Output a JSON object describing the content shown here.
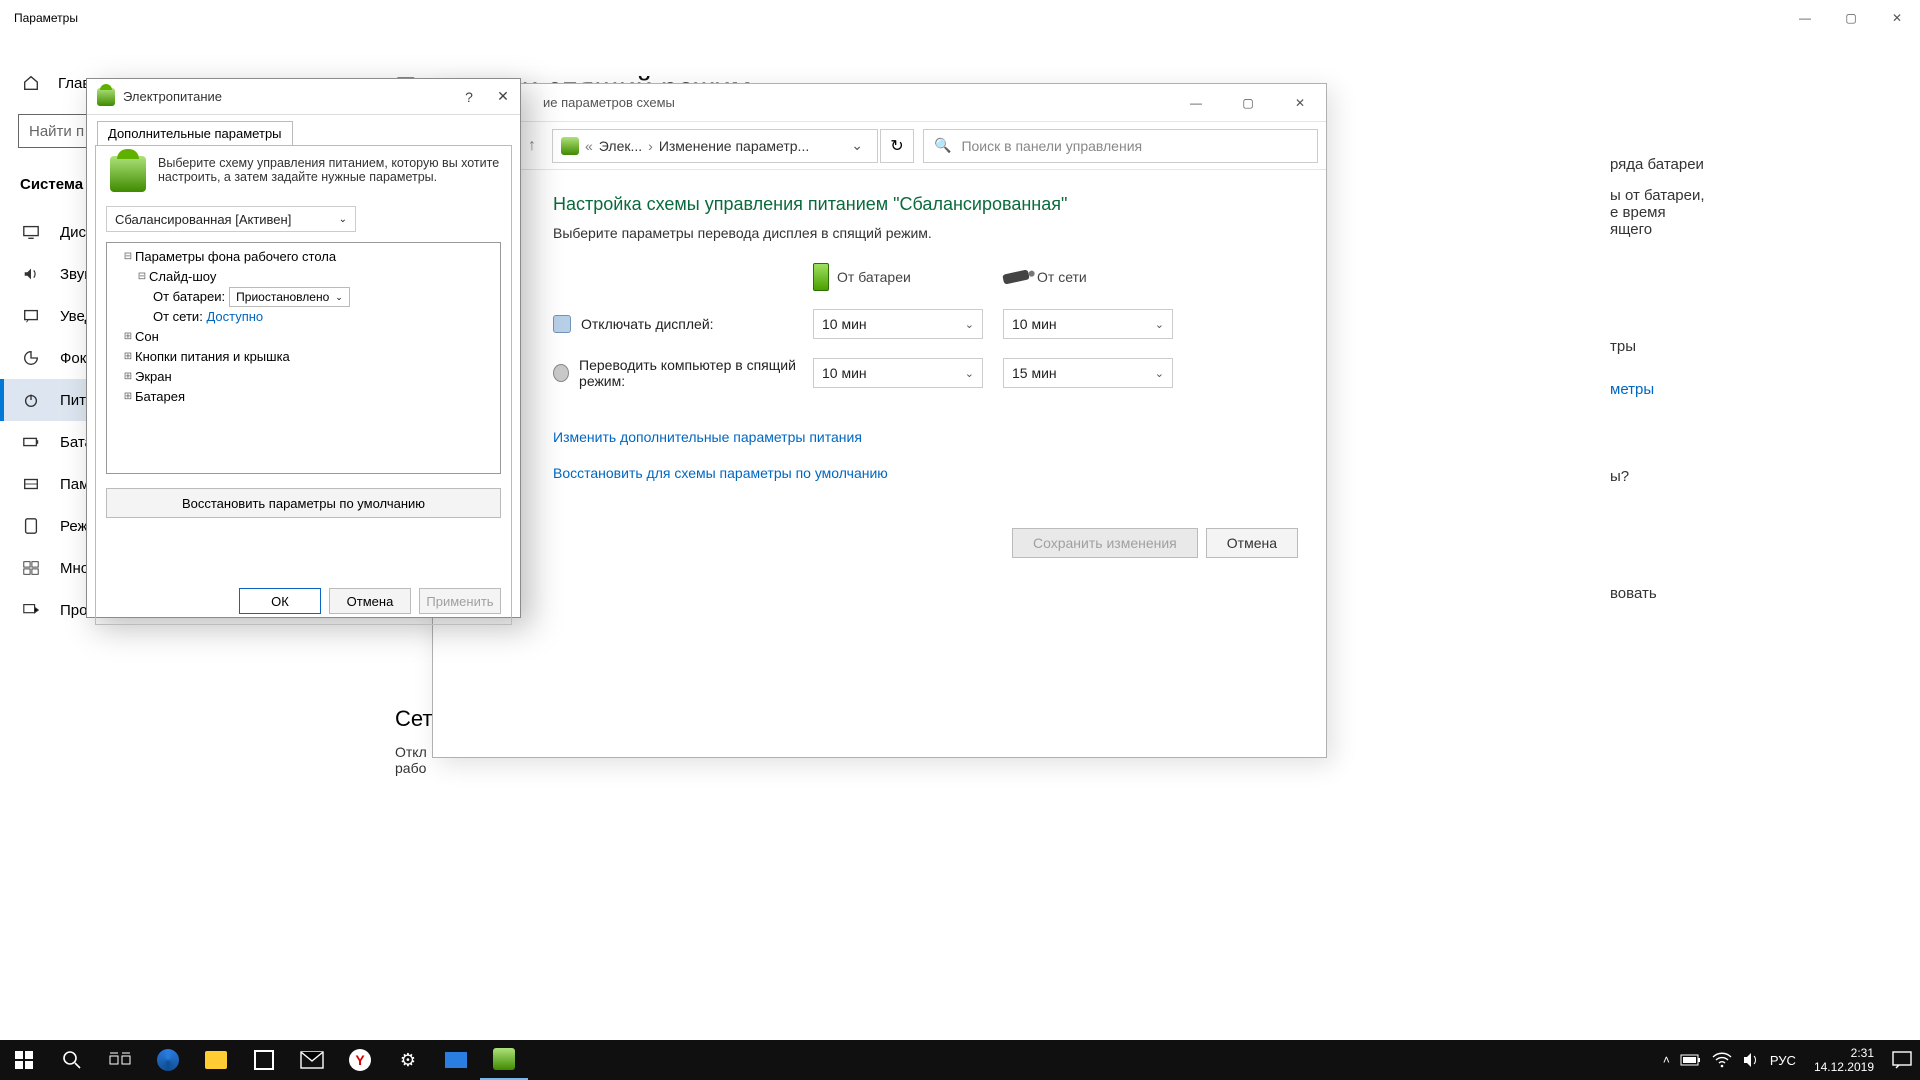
{
  "settings": {
    "title": "Параметры",
    "home": "Главная",
    "search_placeholder": "Найти п",
    "category": "Система",
    "items": [
      {
        "label": "Дисплей",
        "icon": "display-icon"
      },
      {
        "label": "Звук",
        "icon": "sound-icon"
      },
      {
        "label": "Уведомления",
        "icon": "notifications-icon"
      },
      {
        "label": "Фокус",
        "icon": "focus-icon"
      },
      {
        "label": "Питание",
        "icon": "power-icon",
        "active": true
      },
      {
        "label": "Батарея",
        "icon": "battery-icon"
      },
      {
        "label": "Память",
        "icon": "storage-icon"
      },
      {
        "label": "Режим планшета",
        "icon": "tablet-icon"
      },
      {
        "label": "Многозадачность",
        "icon": "multitask-icon"
      },
      {
        "label": "Проецирование на этот компьютер",
        "icon": "project-icon"
      }
    ],
    "page_heading": "Питание и спящий режим",
    "section_bottom": "Сете",
    "bottom_truncated": "Откл\nрабо",
    "right_snippet1": "ряда батареи",
    "right_snippet2": "ы от батареи,\nе время\nящего",
    "right_link1": "тры",
    "right_link2": "метры",
    "right_q": "ы?",
    "right_link3": "вовать"
  },
  "plan_window": {
    "title_suffix": "ие параметров схемы",
    "breadcrumb": {
      "sep": "«",
      "part1": "Элек...",
      "part2": "Изменение параметр..."
    },
    "search_placeholder": "Поиск в панели управления",
    "heading": "Настройка схемы управления питанием \"Сбалансированная\"",
    "subheading": "Выберите параметры перевода дисплея в спящий режим.",
    "col_battery": "От батареи",
    "col_ac": "От сети",
    "row_display": "Отключать дисплей:",
    "row_sleep": "Переводить компьютер в спящий режим:",
    "display_batt": "10 мин",
    "display_ac": "10 мин",
    "sleep_batt": "10 мин",
    "sleep_ac": "15 мин",
    "link_adv": "Изменить дополнительные параметры питания",
    "link_restore": "Восстановить для схемы параметры по умолчанию",
    "btn_save": "Сохранить изменения",
    "btn_cancel": "Отмена"
  },
  "adv_dialog": {
    "title": "Электропитание",
    "tab": "Дополнительные параметры",
    "desc": "Выберите схему управления питанием, которую вы хотите настроить, а затем задайте нужные параметры.",
    "scheme": "Сбалансированная [Активен]",
    "tree": {
      "root": "Параметры фона рабочего стола",
      "slideshow": "Слайд-шоу",
      "on_batt_label": "От батареи:",
      "on_batt_val": "Приостановлено",
      "on_ac_label": "От сети:",
      "on_ac_val": "Доступно",
      "sleep": "Сон",
      "buttons_lid": "Кнопки питания и крышка",
      "screen": "Экран",
      "battery": "Батарея"
    },
    "restore_defaults": "Восстановить параметры по умолчанию",
    "ok": "ОК",
    "cancel": "Отмена",
    "apply": "Применить"
  },
  "taskbar": {
    "lang": "РУС",
    "time": "2:31",
    "date": "14.12.2019"
  }
}
